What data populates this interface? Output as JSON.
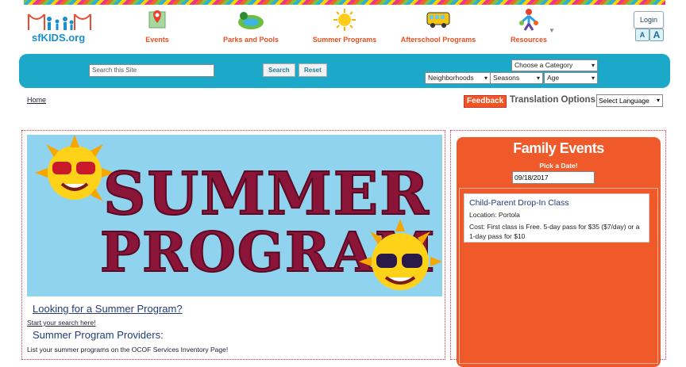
{
  "logo": {
    "text": "sfKIDS.org"
  },
  "nav": [
    {
      "label": "Events",
      "icon": "map-pin-icon"
    },
    {
      "label": "Parks and Pools",
      "icon": "park-pool-icon"
    },
    {
      "label": "Summer Programs",
      "icon": "sun-icon"
    },
    {
      "label": "Afterschool Programs",
      "icon": "school-bus-icon"
    },
    {
      "label": "Resources",
      "icon": "people-icon"
    }
  ],
  "account": {
    "login_label": "Login",
    "font_small": "A",
    "font_large": "A"
  },
  "searchbar": {
    "placeholder": "Search this Site",
    "search_label": "Search",
    "reset_label": "Reset",
    "category": "Choose a Category",
    "neighborhoods": "Neighborhoods",
    "seasons": "Seasons",
    "age": "Age"
  },
  "breadcrumb": {
    "home": "Home"
  },
  "utility": {
    "feedback": "Feedback",
    "translation": "Translation Options",
    "language": "Select Language"
  },
  "banner": {
    "line1": "SUMMER",
    "line2": "PROGRAM"
  },
  "main": {
    "looking": "Looking for a Summer Program?",
    "start": "Start your search here!",
    "providers": "Summer Program Providers:",
    "list": "List your summer programs on the OCOF Services Inventory Page!"
  },
  "events": {
    "title": "Family Events",
    "pick": "Pick a Date!",
    "date": "09/18/2017",
    "items": [
      {
        "title": "Child-Parent Drop-In Class",
        "location": "Location: Portola",
        "cost": "Cost: First class is Free. 5-day pass for $35 ($7/day) or a 1-day pass for $10"
      }
    ]
  },
  "colors": {
    "accent_orange": "#f05a2a",
    "bar_blue": "#1ba8c9",
    "banner_maroon": "#8a1538"
  }
}
